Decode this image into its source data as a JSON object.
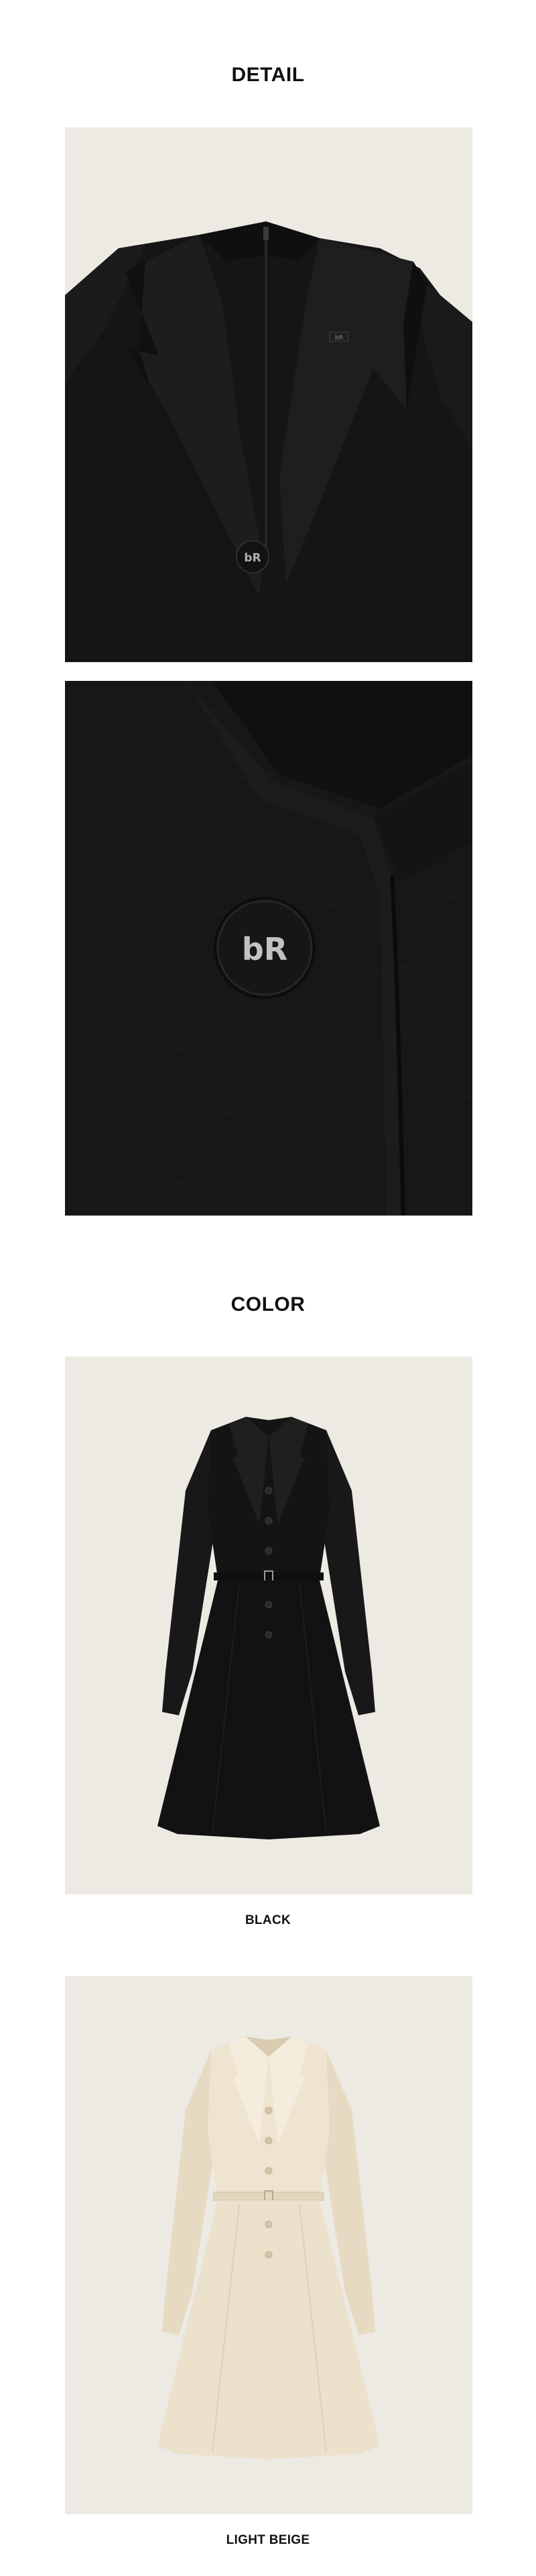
{
  "detail": {
    "title": "DETAIL"
  },
  "color": {
    "title": "COLOR",
    "options": [
      {
        "label": "BLACK",
        "swatch": "#141414"
      },
      {
        "label": "LIGHT BEIGE",
        "swatch": "#ece2cc"
      }
    ]
  },
  "colors": {
    "panel_background": "#ede9e3",
    "black_fabric": "#161616",
    "beige_fabric": "#ece3cf"
  },
  "icons": {
    "button_logo": "monogram-button-icon"
  }
}
